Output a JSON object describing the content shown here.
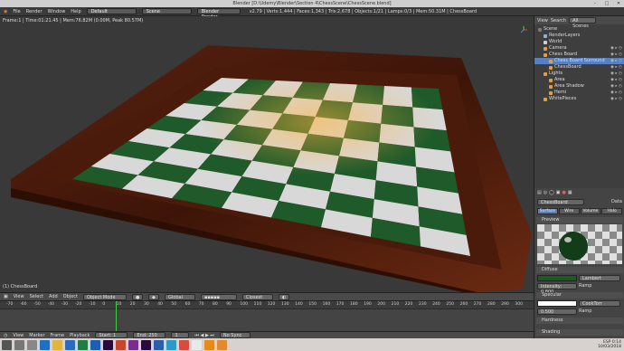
{
  "window": {
    "title": "Blender [D:\\Udemy\\Blender\\Section 4\\ChessScene\\ChessScene.blend]"
  },
  "info_bar": {
    "menus": [
      "File",
      "Render",
      "Window",
      "Help"
    ],
    "layout": "Default",
    "scene": "Scene",
    "engine": "Blender Render",
    "stats": "v2.79 | Verts:1,444 | Faces:1,343 | Tris:2,678 | Objects:1/21 | Lamps:0/3 | Mem:50.31M | ChessBoard"
  },
  "viewport": {
    "stats_line": "Frame:1 | Time:01:21.45 | Mem:76.82M (0.00M, Peak 80.57M)",
    "object_label": "(1) ChessBoard"
  },
  "viewport_header": {
    "view": "View",
    "select": "Select",
    "add": "Add",
    "object": "Object",
    "mode": "Object Mode",
    "pivot": "Global",
    "snap": "Closest"
  },
  "timeline": {
    "ticks": [
      "-70",
      "-60",
      "-50",
      "-40",
      "-30",
      "-20",
      "-10",
      "0",
      "10",
      "20",
      "30",
      "40",
      "50",
      "60",
      "70",
      "80",
      "90",
      "100",
      "110",
      "120",
      "130",
      "140",
      "150",
      "160",
      "170",
      "180",
      "190",
      "200",
      "210",
      "220",
      "230",
      "240",
      "250",
      "260",
      "270",
      "280",
      "290",
      "300"
    ],
    "menus": [
      "View",
      "Marker",
      "Frame",
      "Playback"
    ],
    "start_label": "Start:",
    "start": "1",
    "end_label": "End:",
    "end": "250",
    "current": "1",
    "sync": "No Sync"
  },
  "outliner": {
    "header": {
      "view": "View",
      "search": "Search",
      "scenes": "All Scenes"
    },
    "rows": [
      {
        "label": "Scene",
        "indent": 0,
        "color": "#7a7a7a"
      },
      {
        "label": "RenderLayers",
        "indent": 1,
        "color": "#8fb1d8"
      },
      {
        "label": "World",
        "indent": 1,
        "color": "#d0d0d0"
      },
      {
        "label": "Camera",
        "indent": 1,
        "color": "#e0a040"
      },
      {
        "label": "Chess Board",
        "indent": 1,
        "color": "#e0a040"
      },
      {
        "label": "Chess Board Surround",
        "indent": 2,
        "color": "#e0a040"
      },
      {
        "label": "ChessBoard",
        "indent": 2,
        "color": "#e0a040"
      },
      {
        "label": "Lights",
        "indent": 1,
        "color": "#e0a040"
      },
      {
        "label": "Area",
        "indent": 2,
        "color": "#e0a040"
      },
      {
        "label": "Area Shadow",
        "indent": 2,
        "color": "#e0a040"
      },
      {
        "label": "Hemi",
        "indent": 2,
        "color": "#e0a040"
      },
      {
        "label": "WhitePieces",
        "indent": 1,
        "color": "#e0a040"
      }
    ]
  },
  "properties": {
    "material_name": "ChessBoard",
    "data_label": "Data",
    "tabs": [
      "Surface",
      "Wire",
      "Volume",
      "Halo"
    ],
    "preview_title": "Preview",
    "diffuse_title": "Diffuse",
    "diffuse_shader": "Lambert",
    "intensity_label": "Intensity:",
    "intensity": "0.800",
    "ramp": "Ramp",
    "specular_title": "Specular",
    "specular_shader": "CookTorr",
    "spec_intensity": "0.500",
    "hardness_title": "Hardness",
    "shading_title": "Shading"
  },
  "taskbar": {
    "lang": "ESP",
    "time": "0:14",
    "date": "10/03/2018"
  },
  "colors": {
    "accent": "#5680c2",
    "timeline_cursor": "#3ad13a",
    "diffuse": "#1a5c22"
  }
}
